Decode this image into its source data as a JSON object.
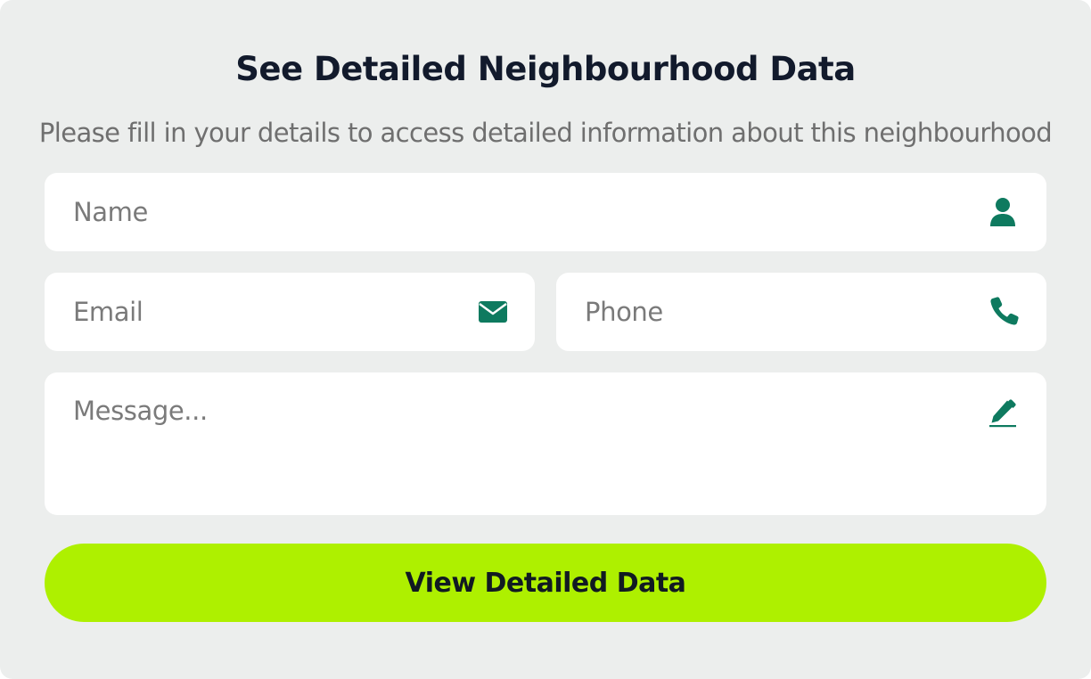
{
  "form": {
    "title": "See Detailed Neighbourhood Data",
    "subtitle": "Please fill in your details to access detailed information about this neighbourhood",
    "fields": {
      "name": {
        "placeholder": "Name",
        "icon": "user-icon"
      },
      "email": {
        "placeholder": "Email",
        "icon": "envelope-icon"
      },
      "phone": {
        "placeholder": "Phone",
        "icon": "phone-icon"
      },
      "message": {
        "placeholder": "Message...",
        "icon": "pencil-icon"
      }
    },
    "submit_label": "View Detailed Data"
  },
  "colors": {
    "background": "#eceeed",
    "field_background": "#ffffff",
    "icon": "#0e7a5f",
    "button": "#aef000",
    "title": "#121a2c",
    "subtitle": "#6f6f6f"
  }
}
